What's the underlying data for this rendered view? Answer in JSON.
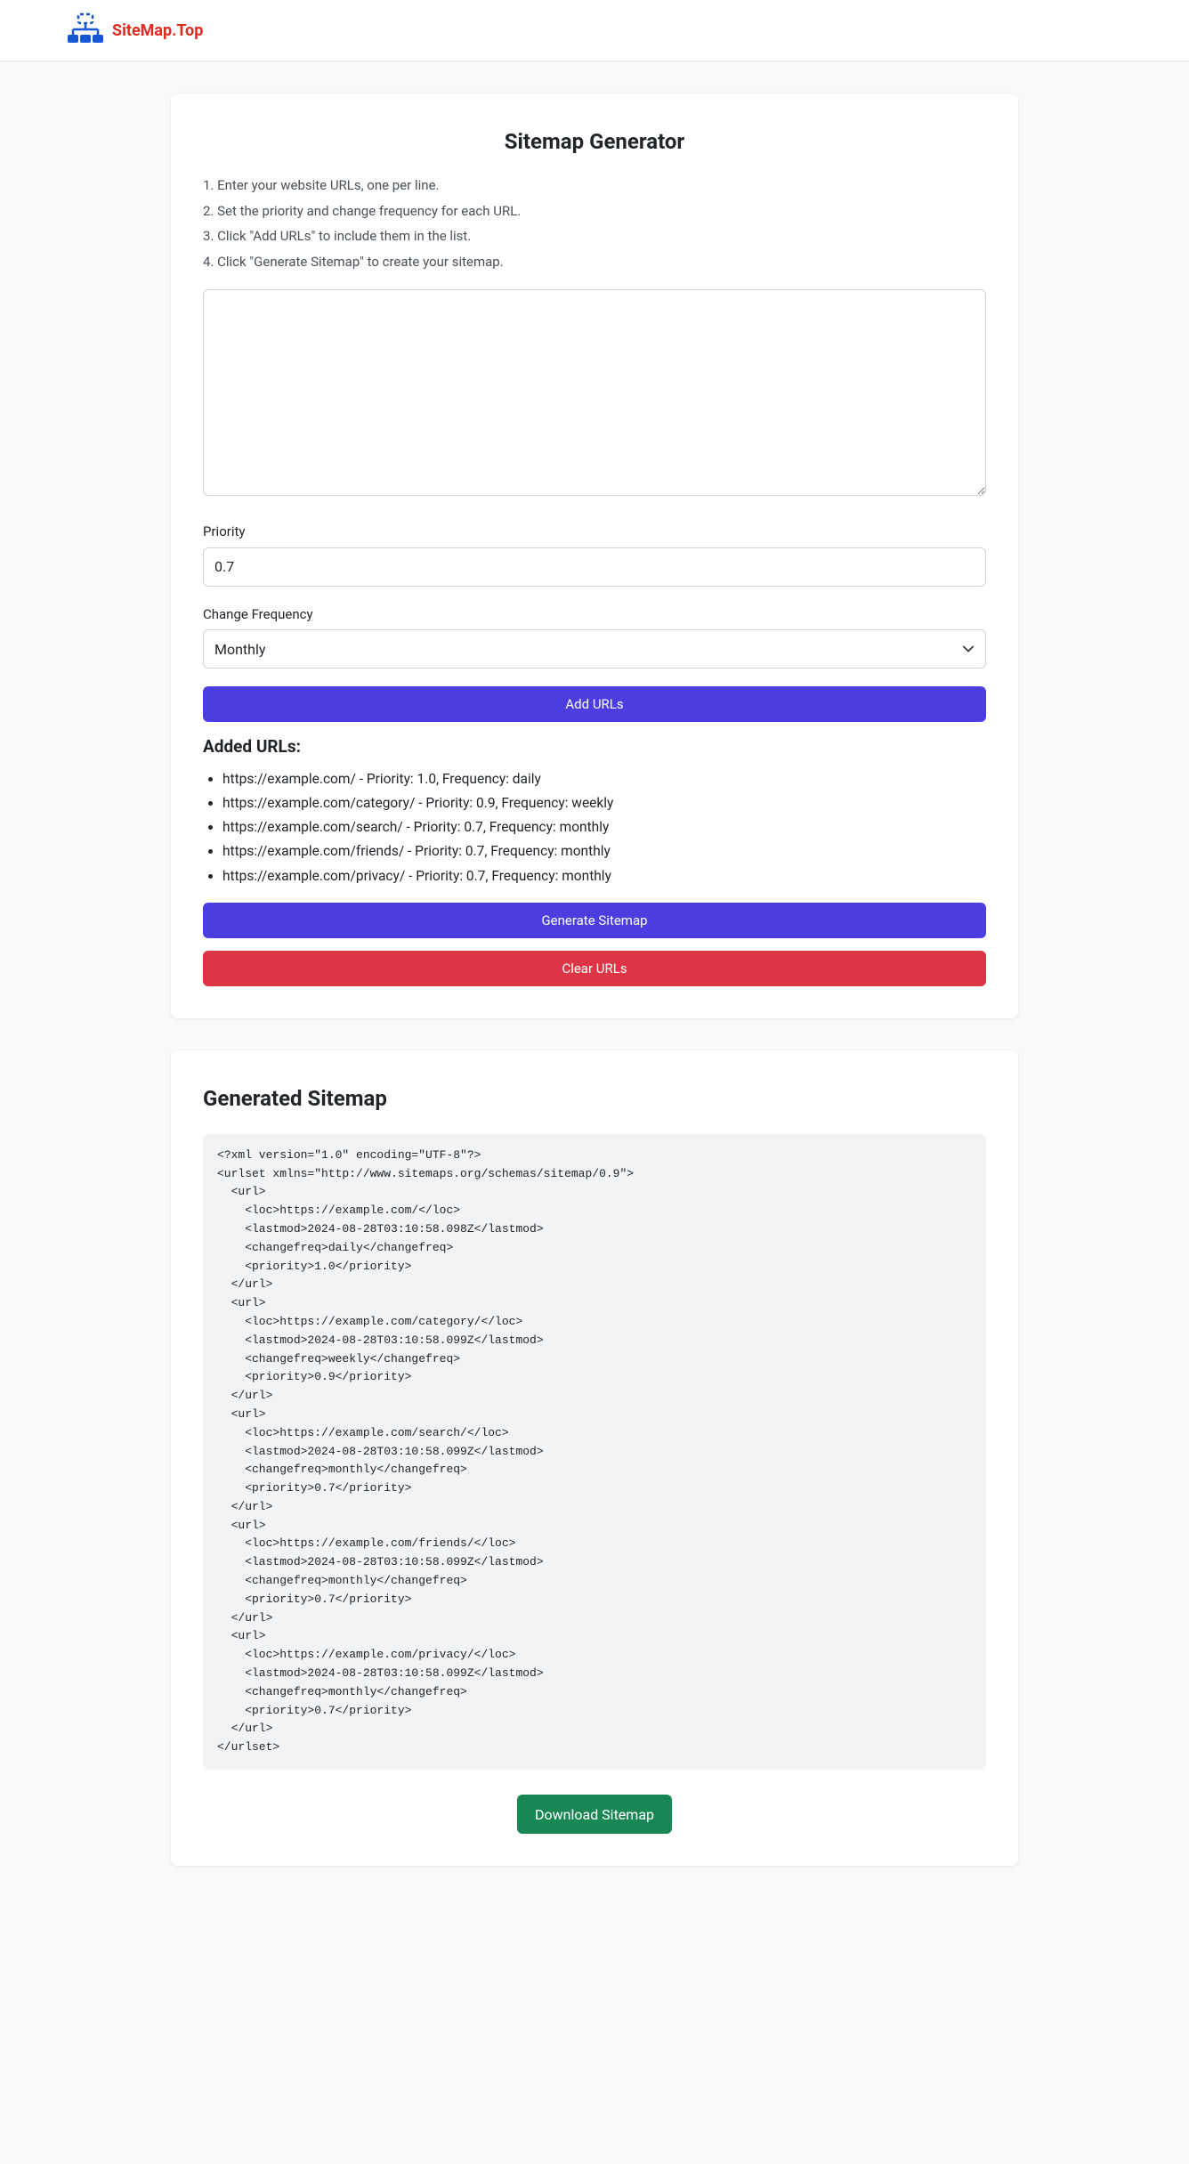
{
  "brand": {
    "name": "SiteMap.Top"
  },
  "title": "Sitemap Generator",
  "instructions": [
    "Enter your website URLs, one per line.",
    "Set the priority and change frequency for each URL.",
    "Click \"Add URLs\" to include them in the list.",
    "Click \"Generate Sitemap\" to create your sitemap."
  ],
  "form": {
    "priority_label": "Priority",
    "priority_value": "0.7",
    "changefreq_label": "Change Frequency",
    "changefreq_value": "Monthly",
    "add_button": "Add URLs"
  },
  "added": {
    "heading": "Added URLs:",
    "items": [
      "https://example.com/ - Priority: 1.0, Frequency: daily",
      "https://example.com/category/ - Priority: 0.9, Frequency: weekly",
      "https://example.com/search/ - Priority: 0.7, Frequency: monthly",
      "https://example.com/friends/ - Priority: 0.7, Frequency: monthly",
      "https://example.com/privacy/ - Priority: 0.7, Frequency: monthly"
    ],
    "generate_button": "Generate Sitemap",
    "clear_button": "Clear URLs"
  },
  "output": {
    "heading": "Generated Sitemap",
    "download_button": "Download Sitemap",
    "xml": "<?xml version=\"1.0\" encoding=\"UTF-8\"?>\n<urlset xmlns=\"http://www.sitemaps.org/schemas/sitemap/0.9\">\n  <url>\n    <loc>https://example.com/</loc>\n    <lastmod>2024-08-28T03:10:58.098Z</lastmod>\n    <changefreq>daily</changefreq>\n    <priority>1.0</priority>\n  </url>\n  <url>\n    <loc>https://example.com/category/</loc>\n    <lastmod>2024-08-28T03:10:58.099Z</lastmod>\n    <changefreq>weekly</changefreq>\n    <priority>0.9</priority>\n  </url>\n  <url>\n    <loc>https://example.com/search/</loc>\n    <lastmod>2024-08-28T03:10:58.099Z</lastmod>\n    <changefreq>monthly</changefreq>\n    <priority>0.7</priority>\n  </url>\n  <url>\n    <loc>https://example.com/friends/</loc>\n    <lastmod>2024-08-28T03:10:58.099Z</lastmod>\n    <changefreq>monthly</changefreq>\n    <priority>0.7</priority>\n  </url>\n  <url>\n    <loc>https://example.com/privacy/</loc>\n    <lastmod>2024-08-28T03:10:58.099Z</lastmod>\n    <changefreq>monthly</changefreq>\n    <priority>0.7</priority>\n  </url>\n</urlset>"
  }
}
